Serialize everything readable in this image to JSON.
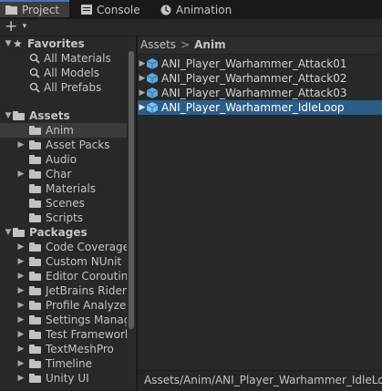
{
  "tabs": [
    {
      "label": "Project",
      "icon": "folder-icon"
    },
    {
      "label": "Console",
      "icon": "console-icon"
    },
    {
      "label": "Animation",
      "icon": "animation-icon"
    }
  ],
  "toolbar": {
    "add_label": "+",
    "add_dropdown": "▾"
  },
  "favorites": {
    "label": "Favorites",
    "items": [
      "All Materials",
      "All Models",
      "All Prefabs"
    ]
  },
  "assets": {
    "label": "Assets",
    "items": [
      "Anim",
      "Asset Packs",
      "Audio",
      "Char",
      "Materials",
      "Scenes",
      "Scripts"
    ]
  },
  "packages": {
    "label": "Packages",
    "items": [
      "Code Coverage",
      "Custom NUnit",
      "Editor Coroutine",
      "JetBrains Rider",
      "Profile Analyzer",
      "Settings Manag",
      "Test Framework",
      "TextMeshPro",
      "Timeline",
      "Unity UI"
    ]
  },
  "breadcrumb": {
    "root": "Assets",
    "separator": ">",
    "current": "Anim"
  },
  "files": [
    "ANI_Player_Warhammer_Attack01",
    "ANI_Player_Warhammer_Attack02",
    "ANI_Player_Warhammer_Attack03",
    "ANI_Player_Warhammer_IdleLoop"
  ],
  "status": {
    "path": "Assets/Anim/ANI_Player_Warhammer_IdleLoop.fbx"
  },
  "colors": {
    "accent": "#3a79bb",
    "selection": "#2c5d87",
    "cube": "#5aa9e0"
  }
}
